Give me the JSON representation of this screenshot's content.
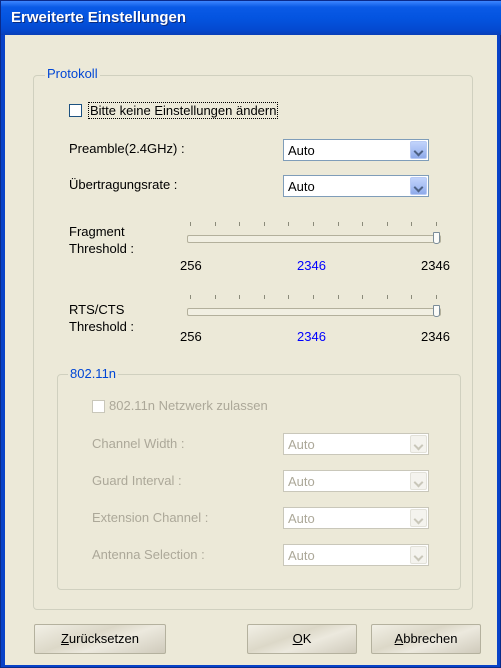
{
  "window": {
    "title": "Erweiterte Einstellungen"
  },
  "protokoll": {
    "group_label": "Protokoll",
    "no_change_checkbox": {
      "label": "Bitte keine Einstellungen ändern",
      "checked": false
    },
    "preamble": {
      "label": "Preamble(2.4GHz) :",
      "value": "Auto"
    },
    "rate": {
      "label": "Übertragungsrate :",
      "value": "Auto"
    },
    "fragment": {
      "label_line1": "Fragment",
      "label_line2": "Threshold :",
      "min": "256",
      "current": "2346",
      "max": "2346"
    },
    "rts": {
      "label_line1": "RTS/CTS",
      "label_line2": "Threshold :",
      "min": "256",
      "current": "2346",
      "max": "2346"
    }
  },
  "n80211": {
    "group_label": "802.11n",
    "allow_checkbox": {
      "label": "802.11n Netzwerk zulassen",
      "checked": false
    },
    "channel_width": {
      "label": "Channel Width :",
      "value": "Auto"
    },
    "guard_interval": {
      "label": "Guard Interval :",
      "value": "Auto"
    },
    "extension_channel": {
      "label": "Extension Channel :",
      "value": "Auto"
    },
    "antenna_selection": {
      "label": "Antenna Selection :",
      "value": "Auto"
    }
  },
  "buttons": {
    "reset": {
      "mnemonic": "Z",
      "rest": "urücksetzen"
    },
    "ok": {
      "mnemonic": "O",
      "rest": "K"
    },
    "cancel": {
      "mnemonic": "A",
      "rest": "bbrechen"
    }
  },
  "colors": {
    "title_bar": "#0454e0",
    "dialog_bg": "#ece9d8",
    "group_label": "#0046d5",
    "slider_value": "#0000ff",
    "disabled_text": "#aca899"
  },
  "icons": {
    "combo_arrow": "chevron-down-icon"
  }
}
